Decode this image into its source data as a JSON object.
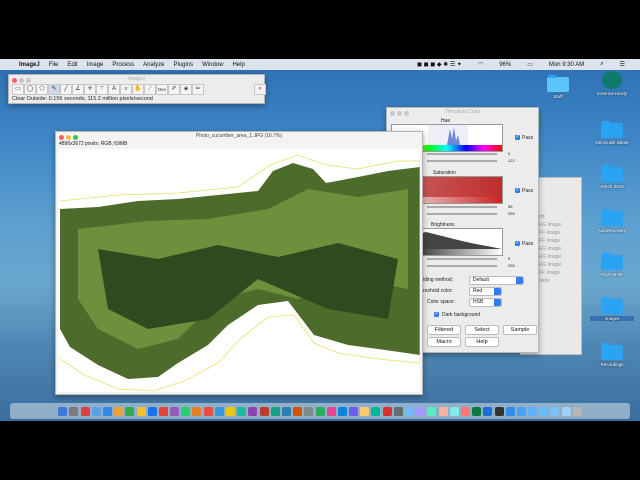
{
  "menubar": {
    "app": "ImageJ",
    "items": [
      "File",
      "Edit",
      "Image",
      "Process",
      "Analyze",
      "Plugins",
      "Window",
      "Help"
    ],
    "battery": "96%",
    "clock": "Mon 9:30 AM"
  },
  "imagej_toolbar": {
    "title": "ImageJ",
    "tools": [
      "rectangle",
      "oval",
      "polygon",
      "freehand",
      "line",
      "angle",
      "point",
      "wand",
      "text",
      "magnifier",
      "hand",
      "dropper",
      "Dev",
      "brush",
      "flood",
      "pencil",
      "more"
    ],
    "active_tool_index": 3,
    "status": "Clear Outside: 0.156 seconds, 115.2 million pixels/second"
  },
  "image_window": {
    "title": "Photo_cucumber_area_1.JPG (16.7%)",
    "info": "4896x3672 pixels; RGB; 69MB",
    "accent": "#e8e06a"
  },
  "threshold_window": {
    "title": "Threshold Color",
    "hue": {
      "label": "Hue",
      "pass_label": "Pass",
      "min": "0",
      "max": "122"
    },
    "saturation": {
      "label": "Saturation",
      "pass_label": "Pass",
      "min": "58",
      "max": "255"
    },
    "brightness": {
      "label": "Brightness",
      "pass_label": "Pass",
      "min": "9",
      "max": "255"
    },
    "method_label": "lding method:",
    "method_value": "Default",
    "color_label": "reshold color:",
    "color_value": "Red",
    "space_label": "Color space:",
    "space_value": "HSB",
    "dark_background": "Dark background",
    "buttons": {
      "filtered": "Filtered",
      "select": "Select",
      "sample": "Sample",
      "macro": "Macro",
      "help": "Help"
    }
  },
  "background_window": {
    "items": [
      "nd",
      "EG image",
      "FF image",
      "FF image",
      "EG image",
      "EG image",
      "EG image",
      "FF image",
      "older"
    ]
  },
  "desktop": {
    "icons": [
      {
        "label": "Stuff"
      },
      {
        "label": "External Hardy"
      },
      {
        "label": "Nemcuktir Bleae"
      },
      {
        "label": "ASHS 2019"
      },
      {
        "label": "AutoRecovery"
      },
      {
        "label": "Figs 05-08"
      },
      {
        "label": "Images"
      },
      {
        "label": "Recordings"
      }
    ]
  },
  "dock": {
    "icon_colors": [
      "#3a79d8",
      "#7a7a7a",
      "#d94141",
      "#5aa0e8",
      "#2f86e4",
      "#e8a33a",
      "#34a853",
      "#f2c12e",
      "#1a73e8",
      "#e34234",
      "#9b59b6",
      "#2ecc71",
      "#e67e22",
      "#e74c3c",
      "#3498db",
      "#f1c40f",
      "#1abc9c",
      "#8e44ad",
      "#c0392b",
      "#16a085",
      "#2980b9",
      "#d35400",
      "#7f8c8d",
      "#27ae60",
      "#e84393",
      "#0984e3",
      "#6c5ce7",
      "#fdcb6e",
      "#00b894",
      "#d63031",
      "#636e72",
      "#74b9ff",
      "#a29bfe",
      "#55efc4",
      "#fab1a0",
      "#81ecec",
      "#ff7675",
      "#0a7b3e",
      "#1e6bd6",
      "#333333",
      "#2d8cf0",
      "#4aa3f0",
      "#5fb0f5",
      "#6cbaf5",
      "#7ac2f5",
      "#9fd1f7",
      "#b5b5b5"
    ]
  }
}
